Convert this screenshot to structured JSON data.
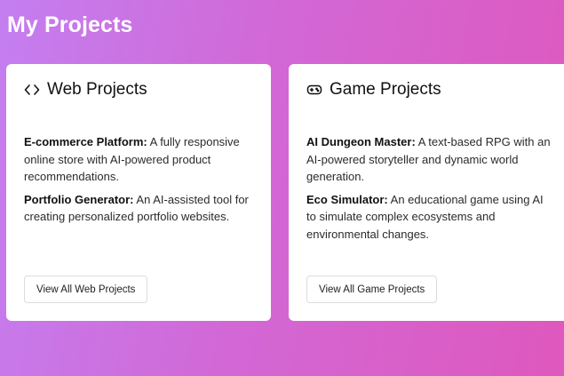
{
  "page": {
    "title": "My Projects"
  },
  "web": {
    "icon": "code-brackets-icon",
    "title": "Web Projects",
    "projects": [
      {
        "name": "E-commerce Platform:",
        "description": "A fully responsive online store with AI-powered product recommendations."
      },
      {
        "name": "Portfolio Generator:",
        "description": "An AI-assisted tool for creating personalized portfolio websites."
      }
    ],
    "button_label": "View All Web Projects"
  },
  "game": {
    "icon": "gamepad-icon",
    "title": "Game Projects",
    "projects": [
      {
        "name": "AI Dungeon Master:",
        "description": "A text-based RPG with an AI-powered storyteller and dynamic world generation."
      },
      {
        "name": "Eco Simulator:",
        "description": "An educational game using AI to simulate complex ecosystems and environmental changes."
      }
    ],
    "button_label": "View All Game Projects"
  }
}
